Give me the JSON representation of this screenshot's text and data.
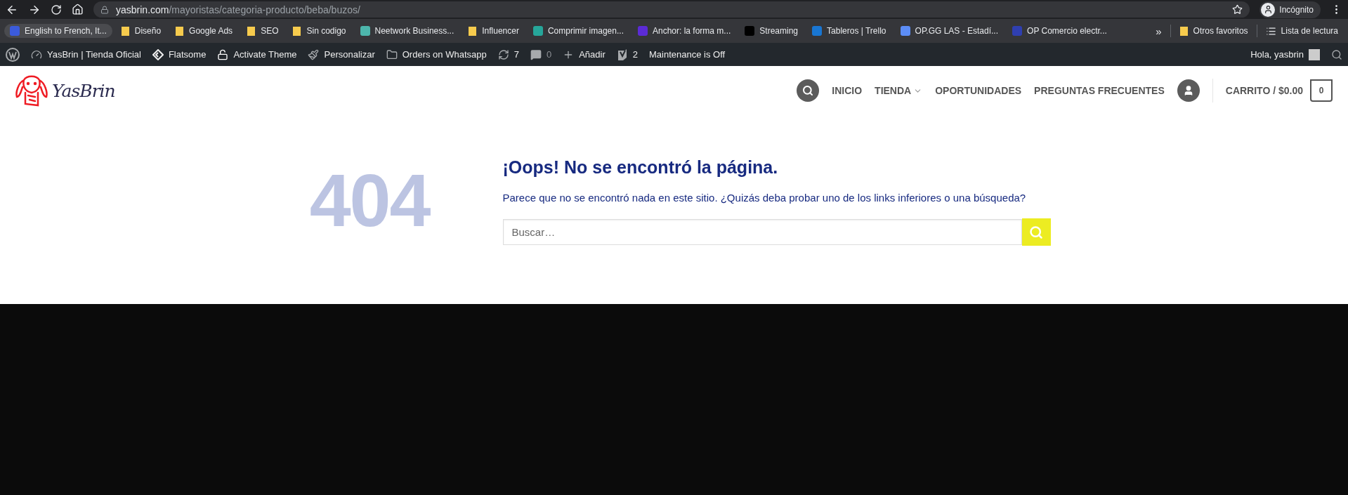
{
  "browser": {
    "address": {
      "domain": "yasbrin.com",
      "path": "/mayoristas/categoria-producto/beba/buzos/"
    },
    "profile": "Incógnito"
  },
  "bookmarks": [
    {
      "label": "English to French, It...",
      "kind": "site",
      "color": "#3b5bdb"
    },
    {
      "label": "Diseño",
      "kind": "folder"
    },
    {
      "label": "Google Ads",
      "kind": "folder"
    },
    {
      "label": "SEO",
      "kind": "folder"
    },
    {
      "label": "Sin codigo",
      "kind": "folder"
    },
    {
      "label": "Neetwork Business...",
      "kind": "site",
      "color": "#4db6ac"
    },
    {
      "label": "Influencer",
      "kind": "folder"
    },
    {
      "label": "Comprimir imagen...",
      "kind": "site",
      "color": "#26a69a"
    },
    {
      "label": "Anchor: la forma m...",
      "kind": "site",
      "color": "#5b2bd6"
    },
    {
      "label": "Streaming",
      "kind": "site",
      "color": "#000000"
    },
    {
      "label": "Tableros | Trello",
      "kind": "site",
      "color": "#1976d2"
    },
    {
      "label": "OP.GG LAS - Estadí...",
      "kind": "site",
      "color": "#5c8df6"
    },
    {
      "label": "OP Comercio electr...",
      "kind": "site",
      "color": "#2f3fb0"
    }
  ],
  "bookmarks_overflow": "»",
  "bookmarks_right": [
    {
      "label": "Otros favoritos",
      "kind": "folder"
    },
    {
      "label": "Lista de lectura",
      "kind": "list"
    }
  ],
  "admin_bar": {
    "items": [
      {
        "label": "YasBrin | Tienda Oficial"
      },
      {
        "label": "Flatsome"
      },
      {
        "label": "Activate Theme"
      },
      {
        "label": "Personalizar"
      },
      {
        "label": "Orders on Whatsapp"
      },
      {
        "label": "7",
        "disabled": false
      },
      {
        "label": "0",
        "disabled": true
      },
      {
        "label": "Añadir"
      },
      {
        "label": "2"
      },
      {
        "label": "Maintenance is Off"
      }
    ],
    "greeting": "Hola, yasbrin"
  },
  "header": {
    "logo": "YasBrin",
    "nav": [
      {
        "label": "INICIO",
        "dropdown": false
      },
      {
        "label": "TIENDA",
        "dropdown": true
      },
      {
        "label": "OPORTUNIDADES",
        "dropdown": false
      },
      {
        "label": "PREGUNTAS FRECUENTES",
        "dropdown": false
      }
    ],
    "cart": "CARRITO / $0.00",
    "cart_count": "0"
  },
  "error": {
    "code": "404",
    "title": "¡Oops! No se encontró la página.",
    "message": "Parece que no se encontró nada en este sitio. ¿Quizás deba probar uno de los links inferiores o una búsqueda?",
    "search": {
      "placeholder": "Buscar…"
    }
  }
}
